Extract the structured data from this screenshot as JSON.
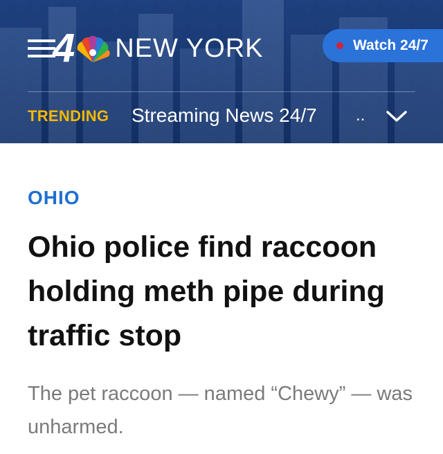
{
  "header": {
    "menu_icon": "hamburger-menu-icon",
    "logo_number": "4",
    "logo_icon": "nbc-peacock-icon",
    "logo_text": "NEW YORK",
    "watch_button_label": "Watch 24/7",
    "live_indicator_color": "#d0243c",
    "watch_button_color": "#2b72d9",
    "background_color": "#1d417e"
  },
  "trending": {
    "label": "TRENDING",
    "label_color": "#f5b800",
    "item": "Streaming News 24/7",
    "overflow": "..",
    "expand_icon": "chevron-down-icon"
  },
  "article": {
    "category": "OHIO",
    "category_color": "#1f6fd1",
    "headline": "Ohio police find raccoon holding meth pipe during traffic stop",
    "dek": "The pet raccoon — named “Chewy” — was unharmed."
  }
}
